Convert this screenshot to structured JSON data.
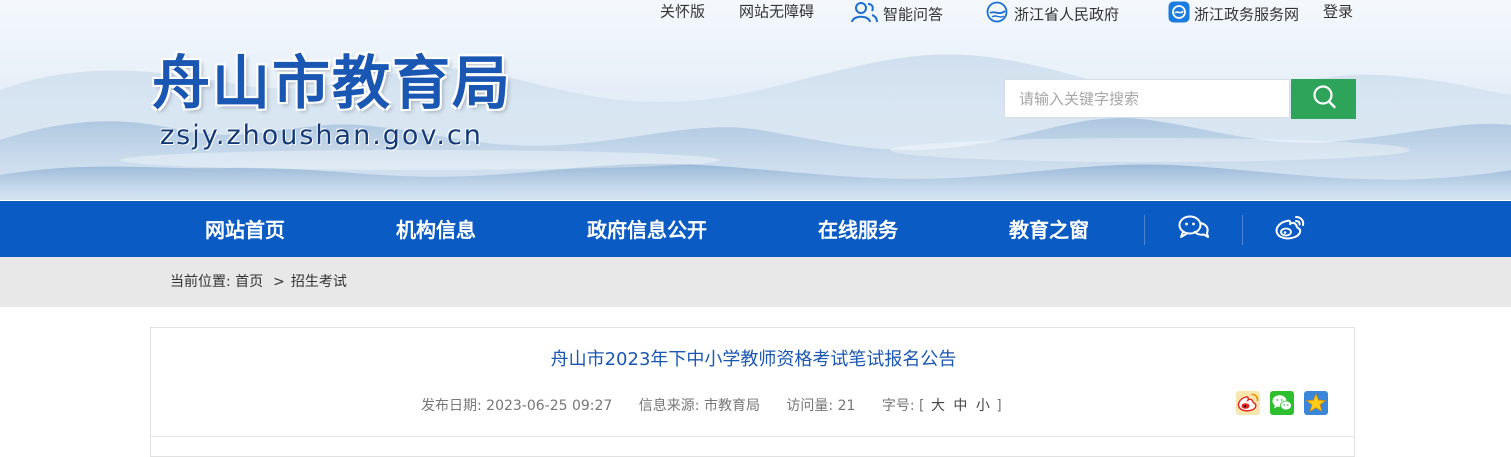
{
  "topbar": {
    "care_mode": "关怀版",
    "accessibility": "网站无障碍",
    "smart_qa": "智能问答",
    "zj_gov": "浙江省人民政府",
    "zj_service": "浙江政务服务网",
    "login": "登录"
  },
  "logo": {
    "title": "舟山市教育局",
    "url": "zsjy.zhoushan.gov.cn"
  },
  "search": {
    "placeholder": "请输入关键字搜索"
  },
  "nav": {
    "items": [
      "网站首页",
      "机构信息",
      "政府信息公开",
      "在线服务",
      "教育之窗"
    ],
    "icons": [
      "wechat-icon",
      "weibo-icon"
    ]
  },
  "breadcrumb": {
    "label": "当前位置:",
    "home": "首页",
    "separator": ">",
    "current": "招生考试"
  },
  "article": {
    "title": "舟山市2023年下中小学教师资格考试笔试报名公告",
    "publish_date": "发布日期: 2023-06-25 09:27",
    "source": "信息来源: 市教育局",
    "visits": "访问量: 21",
    "font_size_label": "字号:",
    "font_size_open": "[",
    "font_large": "大",
    "font_medium": "中",
    "font_small": "小",
    "font_size_close": "]",
    "share_icons": [
      "weibo-share-icon",
      "wechat-share-icon",
      "favorite-star-icon"
    ]
  },
  "colors": {
    "nav_blue": "#0a5bc3",
    "search_green": "#2ea45a",
    "title_blue": "#1a57b3",
    "breadcrumb_gray": "#e8e8e8"
  }
}
